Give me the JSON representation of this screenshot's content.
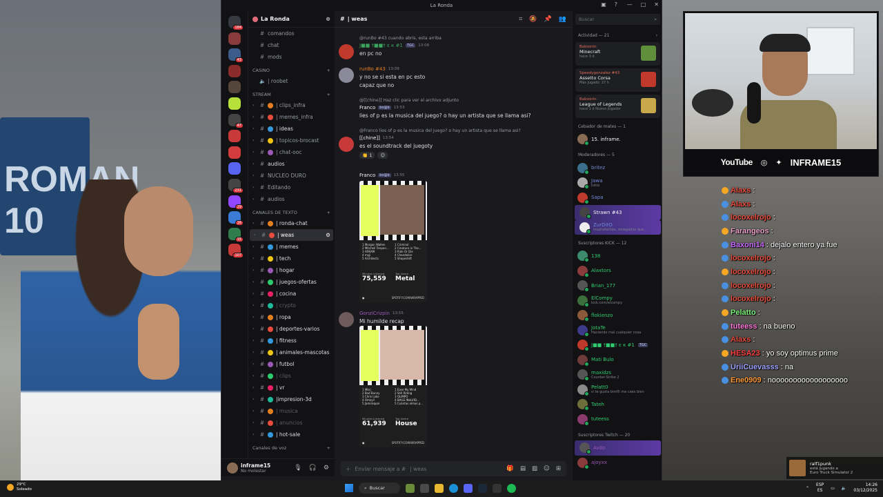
{
  "window": {
    "title": "La Ronda"
  },
  "servers": [
    {
      "color": "#36393f",
      "count": "184"
    },
    {
      "color": "#8a3b3b",
      "count": ""
    },
    {
      "color": "#3b5b8a",
      "count": "43"
    },
    {
      "color": "#8a2b2b",
      "count": ""
    },
    {
      "color": "#55463b",
      "count": ""
    },
    {
      "color": "#b8e03a",
      "count": ""
    },
    {
      "color": "#444",
      "count": "47"
    },
    {
      "color": "#c83a3a",
      "count": ""
    },
    {
      "color": "#d23c3c",
      "count": ""
    },
    {
      "color": "#5865f2",
      "count": ""
    },
    {
      "color": "#444",
      "count": "231"
    },
    {
      "color": "#9146ff",
      "count": "29"
    },
    {
      "color": "#3a7bd5",
      "count": "16"
    },
    {
      "color": "#2f7d4a",
      "count": "15"
    },
    {
      "color": "#c83a3a",
      "count": "107"
    }
  ],
  "guild": {
    "name": "La Ronda"
  },
  "channels": {
    "voice_top": [
      "comandos",
      "chat",
      "mods"
    ],
    "cat_casino": "CASINO",
    "casino": [
      "| roobet"
    ],
    "cat_stream": "STREAM",
    "stream": [
      "| clips_infra",
      "| memes_infra",
      "| ideas",
      "| topicos-brocast",
      "| chat-ooc",
      "audios",
      "NUCLEO DURO",
      "Editando",
      "audios"
    ],
    "cat_text": "CANALES DE TEXTO",
    "text": [
      "| ronda-chat",
      "| weas",
      "| memes",
      "| tech",
      "| hogar",
      "| juegos-ofertas",
      "| cocina",
      "| crypto",
      "| ropa",
      "| deportes-varios",
      "| fitness",
      "| animales-mascotas",
      "| futbol",
      "| clips",
      "| vr",
      "|impresion-3d",
      "| musica",
      "| anuncios",
      "| hot-sale"
    ],
    "cat_voice": "Canales de voz"
  },
  "user": {
    "name": "inframe15",
    "status": "No molestar"
  },
  "chat": {
    "channel": "| weas",
    "composer_placeholder": "Enviar mensaje a #",
    "composer_channel": "| weas",
    "messages": [
      {
        "reply": "@runBo #43  cuando abris, esta arriba",
        "author": "J■■ †■■† є к #1",
        "tag": "TGC",
        "time": "13:08",
        "text": "en pc no",
        "author_color": "#3ba55d"
      },
      {
        "author": "runBo #43",
        "time": "13:09",
        "text1": "y no se si esta en pc esto",
        "text2": "capaz que no",
        "author_color": "#e67e22"
      },
      {
        "reply": "@[[chine]]  Haz clic para ver el archivo adjunto",
        "author": "Franco",
        "tag": "bo@b",
        "time": "13:53",
        "text": "lies of p es la musica del juego? o hay un artista que se llama asi?",
        "author_color": "#f2f3f5"
      },
      {
        "reply": "@Franco  lies of p es la musica del juego? o hay un artista que se llama asi?",
        "author": "[[chine]]",
        "time": "13:54",
        "text": "es el soundtrack del juegoty",
        "author_color": "#f2f3f5",
        "reaction_count": "1"
      },
      {
        "author": "Franco",
        "tag": "bo@b",
        "time": "13:55",
        "author_color": "#f2f3f5"
      },
      {
        "author": "GonziCrizpin",
        "time": "13:55",
        "text": "Mi humilde recap",
        "author_color": "#9b59b6"
      }
    ],
    "wrapped": [
      {
        "artists": [
          "1 Morgan Wallen",
          "2 Mitchell Tenpen...",
          "3 ARKAM",
          "4 myji",
          "5 Architects"
        ],
        "songs": [
          "1 Criminal",
          "2 Creature in The...",
          "3 Ride Or Die",
          "4 Chandelier",
          "5 Shapeshift"
        ],
        "k1": "Minutes Listened",
        "v1": "75,559",
        "k2": "Top Genre",
        "v2": "Metal",
        "foot": "SPOTIFY.COM/WRAPPED"
      },
      {
        "artists": [
          "1 Mbrj",
          "2 Bad Bunny",
          "3 Chris Lake",
          "4 Omeyi!",
          "5 Jamiroquai"
        ],
        "songs": [
          "1 Ease My Mind",
          "2 Still Riding",
          "3 OLIMPO",
          "4 BAILE INoLVID...",
          "5 Cuántas almas p..."
        ],
        "k1": "Minutes Listened",
        "v1": "61,939",
        "k2": "Top Genre",
        "v2": "House",
        "foot": "SPOTIFY.COM/WRAPPED"
      }
    ]
  },
  "members": {
    "search_placeholder": "Buscar",
    "activity_label": "Actividad — 21",
    "activities": [
      {
        "who": "Baboorin",
        "game": "Minecraft",
        "sub": "hace 3 d",
        "color": "#5f8f3a"
      },
      {
        "who": "Speedygonzalez #43",
        "game": "Assetto Corsa",
        "sub": "Más jugado: 27 h",
        "color": "#c0392b"
      },
      {
        "who": "Baboorin",
        "game": "League of Legends",
        "sub": "hace 1 d   Nuevo jugador",
        "color": "#c8a84b"
      }
    ],
    "sections": [
      {
        "label": "Cebador de mates — 1",
        "members": [
          {
            "name": "15. inframe.",
            "status": "",
            "color": "#f2f3f5",
            "av": "#8a6c55"
          }
        ]
      },
      {
        "label": "Moderadores — 5",
        "members": [
          {
            "name": "britez",
            "status": "",
            "color": "#7289da",
            "av": "#3b6e8a"
          },
          {
            "name": "Jawa",
            "status": "tokio",
            "color": "#7289da",
            "av": "#aaa"
          },
          {
            "name": "Sapa",
            "status": "",
            "color": "#7289da",
            "av": "#c0392b"
          },
          {
            "name": "Strawn #43",
            "status": "",
            "color": "#f2f3f5",
            "av": "#444",
            "hl": true
          },
          {
            "name": "ZurDitO",
            "status": "insatisfechos, renegados que...",
            "color": "#7289da",
            "av": "#eee",
            "hl": true
          }
        ]
      },
      {
        "label": "Suscriptores KICK — 12",
        "members": [
          {
            "name": "138",
            "status": "",
            "color": "#2ecc71",
            "av": "#3b8a6e"
          },
          {
            "name": "Alaxtors",
            "status": "",
            "color": "#2ecc71",
            "av": "#8a3b3b"
          },
          {
            "name": "Brian_177",
            "status": "",
            "color": "#2ecc71",
            "av": "#555"
          },
          {
            "name": "ElCompy",
            "status": "kick.com/elcompy",
            "color": "#2ecc71",
            "av": "#3b6e3b"
          },
          {
            "name": "flokienzo",
            "status": "",
            "color": "#2ecc71",
            "av": "#8a5a3b"
          },
          {
            "name": "JotaTe",
            "status": "Haciendo mal cualquier cosa",
            "color": "#2ecc71",
            "av": "#3b3b8a"
          },
          {
            "name": "J■■ †■■† є к #1",
            "status": "",
            "color": "#2ecc71",
            "av": "#c0392b",
            "tag": "TGC"
          },
          {
            "name": "Mati Bulo",
            "status": "",
            "color": "#2ecc71",
            "av": "#6e3b3b"
          },
          {
            "name": "maxidzs",
            "status": "Counter-Strike 2",
            "color": "#2ecc71",
            "av": "#555"
          },
          {
            "name": "Pelatt0",
            "status": "si te gusta bimfli me caes bien",
            "color": "#2ecc71",
            "av": "#8a8a8a"
          },
          {
            "name": "Tateh",
            "status": "",
            "color": "#2ecc71",
            "av": "#6e6e3b"
          },
          {
            "name": "tuteess",
            "status": "",
            "color": "#2ecc71",
            "av": "#8a3b6e"
          }
        ]
      },
      {
        "label": "Suscriptores Twitch — 20",
        "members": [
          {
            "name": "Avdo",
            "status": "",
            "color": "#9b59b6",
            "av": "#555",
            "hl": true
          },
          {
            "name": "ajoyxx",
            "status": "",
            "color": "#9b59b6",
            "av": "#8a3b3b"
          }
        ]
      }
    ]
  },
  "stream": {
    "cam_footer": {
      "yt": "YouTube",
      "handle": "INFRAME15"
    },
    "jersey_text": "ROMAN 10",
    "chat": [
      {
        "user": "Alaxs",
        "msg": ":",
        "color": "#e74c3c"
      },
      {
        "user": "Alaxs",
        "msg": ":",
        "color": "#e74c3c"
      },
      {
        "user": "locoxelrojo",
        "msg": ":",
        "color": "#e74c3c"
      },
      {
        "user": "Farangeos",
        "msg": ":",
        "color": "#e8a0c8"
      },
      {
        "user": "Baxoni14",
        "msg": ": dejalo entero ya fue",
        "color": "#c86bff"
      },
      {
        "user": "locoxelrojo",
        "msg": ":",
        "color": "#e74c3c"
      },
      {
        "user": "locoxelrojo",
        "msg": ":",
        "color": "#e74c3c"
      },
      {
        "user": "locoxelrojo",
        "msg": ":",
        "color": "#e74c3c"
      },
      {
        "user": "locoxelrojo",
        "msg": ":",
        "color": "#e74c3c"
      },
      {
        "user": "Pelatto",
        "msg": ":",
        "color": "#7cf07c"
      },
      {
        "user": "tuteess",
        "msg": ": na bueno",
        "color": "#ff7ad9"
      },
      {
        "user": "Alaxs",
        "msg": ":",
        "color": "#e74c3c"
      },
      {
        "user": "HESA23",
        "msg": ": yo soy optimus prime",
        "color": "#ff4040"
      },
      {
        "user": "UriiCuevasss",
        "msg": ": na",
        "color": "#9fa3ff"
      },
      {
        "user": "Ene0909",
        "msg": ": noooooooooooooooooo",
        "color": "#ff9a3a"
      }
    ],
    "notification": {
      "name": "ralf1punk",
      "line1": "está jugando a",
      "line2": "Euro Truck Simulator 2"
    }
  },
  "taskbar": {
    "temp": "29°C",
    "weather": "Soleado",
    "search": "Buscar",
    "lang1": "ESP",
    "lang2": "ES",
    "time": "14:26",
    "date": "03/12/2025"
  }
}
